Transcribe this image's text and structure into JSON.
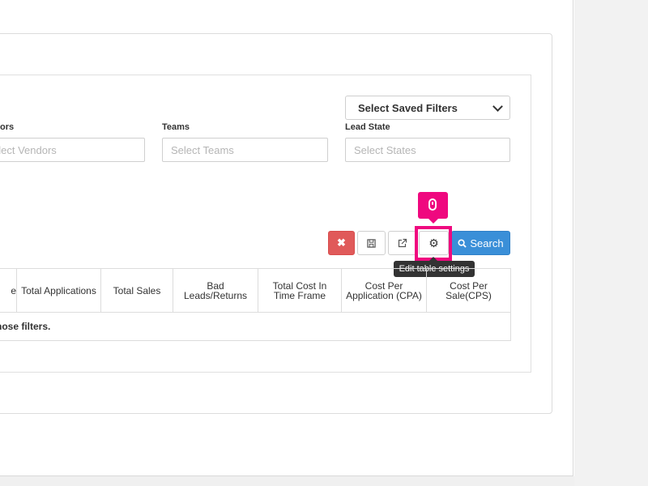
{
  "filters": {
    "saved_filters_label": "Select Saved Filters",
    "vendors_label": "ors",
    "vendors_placeholder": "elect Vendors",
    "teams_label": "Teams",
    "teams_placeholder": "Select Teams",
    "lead_state_label": "Lead State",
    "lead_state_placeholder": "Select States"
  },
  "toolbar": {
    "clear_icon": "✖",
    "settings_icon": "⚙",
    "search_label": "Search",
    "tooltip": "Edit table settings"
  },
  "table": {
    "columns": [
      "e",
      "Total Applications",
      "Total Sales",
      "Bad Leads/Returns",
      "Total Cost In Time Frame",
      "Cost Per Application (CPA)",
      "Cost Per Sale(CPS)"
    ],
    "empty_message": "those filters."
  },
  "colors": {
    "accent_pink": "#ef087f",
    "search_blue": "#3a8fd8",
    "clear_red": "#e05a5a"
  },
  "icons": [
    "times-icon",
    "save-icon",
    "external-link-icon",
    "gear-icon",
    "search-icon",
    "mouse-icon"
  ]
}
